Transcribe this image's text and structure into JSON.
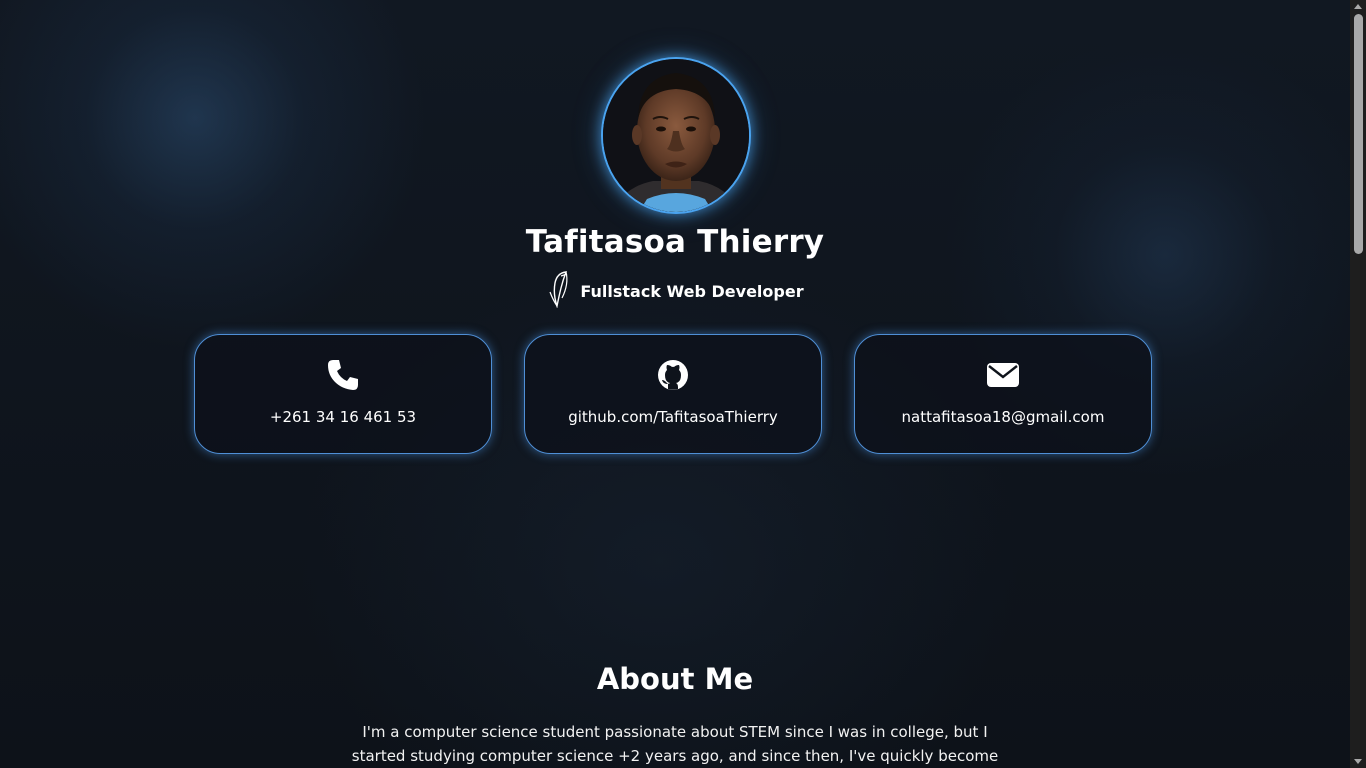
{
  "profile": {
    "name": "Tafitasoa Thierry",
    "role": "Fullstack Web Developer"
  },
  "contacts": [
    {
      "icon": "phone-icon",
      "text": "+261 34 16 461 53"
    },
    {
      "icon": "github-icon",
      "text": "github.com/TafitasoaThierry"
    },
    {
      "icon": "envelope-icon",
      "text": "nattafitasoa18@gmail.com"
    }
  ],
  "about": {
    "title": "About Me",
    "line1": "I'm a computer science student passionate about STEM since I was in college, but I",
    "line2": "started studying computer science +2 years ago, and since then, I've quickly become a"
  },
  "colors": {
    "background": "#0e131b",
    "accent": "#4aa3ef",
    "text": "#ffffff"
  }
}
